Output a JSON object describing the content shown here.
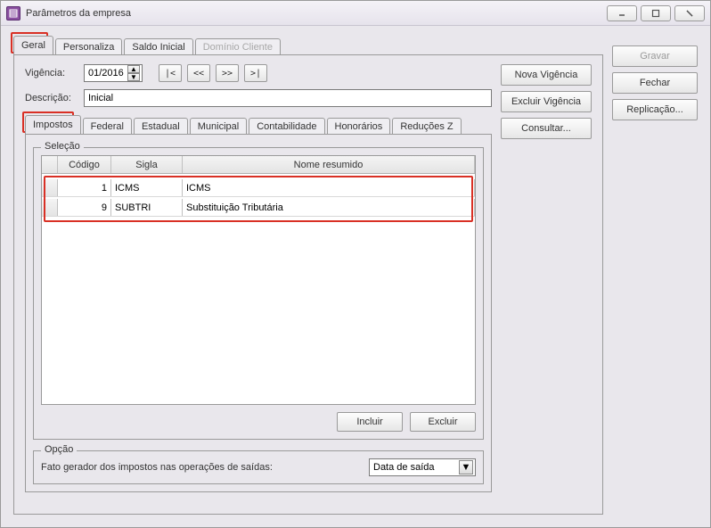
{
  "window": {
    "title": "Parâmetros da empresa"
  },
  "side_buttons": {
    "gravar": "Gravar",
    "fechar": "Fechar",
    "replicacao": "Replicação..."
  },
  "main_tabs": {
    "geral": "Geral",
    "personaliza": "Personaliza",
    "saldo_inicial": "Saldo Inicial",
    "dominio_cliente": "Domínio Cliente"
  },
  "geral": {
    "vigencia_label": "Vigência:",
    "vigencia_value": "01/2016",
    "nav": {
      "first": "|<",
      "prev": "<<",
      "next": ">>",
      "last": ">|"
    },
    "descricao_label": "Descrição:",
    "descricao_value": "Inicial",
    "vig_buttons": {
      "nova": "Nova Vigência",
      "excluir": "Excluir Vigência",
      "consultar": "Consultar..."
    }
  },
  "inner_tabs": {
    "impostos": "Impostos",
    "federal": "Federal",
    "estadual": "Estadual",
    "municipal": "Municipal",
    "contabilidade": "Contabilidade",
    "honorarios": "Honorários",
    "reducoes_z": "Reduções Z"
  },
  "selecao": {
    "legend": "Seleção",
    "headers": {
      "codigo": "Código",
      "sigla": "Sigla",
      "nome": "Nome resumido"
    },
    "rows": [
      {
        "codigo": "1",
        "sigla": "ICMS",
        "nome": "ICMS"
      },
      {
        "codigo": "9",
        "sigla": "SUBTRI",
        "nome": "Substituição Tributária"
      }
    ],
    "incluir": "Incluir",
    "excluir": "Excluir"
  },
  "opcao": {
    "legend": "Opção",
    "fato_label": "Fato gerador dos impostos nas operações de saídas:",
    "fato_value": "Data de saída"
  }
}
